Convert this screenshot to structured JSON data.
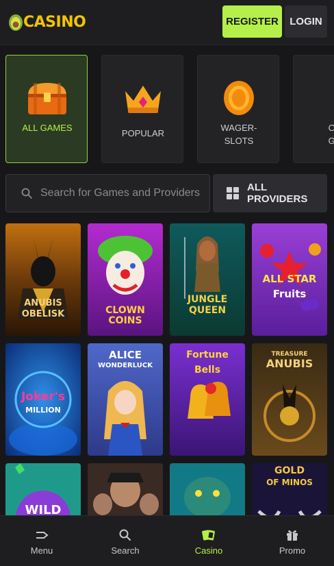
{
  "header": {
    "logo_text": "CASINO",
    "register_label": "REGISTER",
    "login_label": "LOGIN"
  },
  "categories": [
    {
      "label": "ALL GAMES",
      "icon": "treasure-chest-icon",
      "active": true
    },
    {
      "label": "POPULAR",
      "icon": "crown-icon",
      "active": false
    },
    {
      "label_line1": "WAGER-",
      "label_line2": "SLOTS",
      "icon": "coin-icon",
      "active": false
    },
    {
      "label_line1": "CR",
      "label_line2": "GA",
      "icon": "partial-icon",
      "active": false
    }
  ],
  "search": {
    "placeholder": "Search for Games and Providers"
  },
  "providers": {
    "label": "ALL PROVIDERS"
  },
  "games": [
    {
      "title_line1": "ANUBIS",
      "title_line2": "OBELISK"
    },
    {
      "title_line1": "CLOWN COINS"
    },
    {
      "title_line1": "JUNGLE",
      "title_line2": "QUEEN"
    },
    {
      "title_line1": "ALL STAR",
      "title_line2": "Fruits"
    },
    {
      "title_line1": "Joker's",
      "title_line2": "MILLION"
    },
    {
      "title_line1": "ALICE",
      "title_line2": "WONDERLUCK"
    },
    {
      "title_line1": "Fortune",
      "title_line2": "Bells"
    },
    {
      "title_line1": "TREASURE",
      "title_line2": "ANUBIS"
    },
    {
      "title_line1": "WILD"
    },
    {
      "title_line1": ""
    },
    {
      "title_line1": ""
    },
    {
      "title_line1": "GOLD",
      "title_line2": "OF MINOS"
    }
  ],
  "nav": [
    {
      "label": "Menu",
      "icon": "menu-arrow-icon",
      "active": false
    },
    {
      "label": "Search",
      "icon": "search-icon",
      "active": false
    },
    {
      "label": "Casino",
      "icon": "cards-icon",
      "active": true
    },
    {
      "label": "Promo",
      "icon": "gift-icon",
      "active": false
    }
  ],
  "colors": {
    "accent": "#b5f04a",
    "background": "#17171a",
    "logo": "#f2c400"
  }
}
